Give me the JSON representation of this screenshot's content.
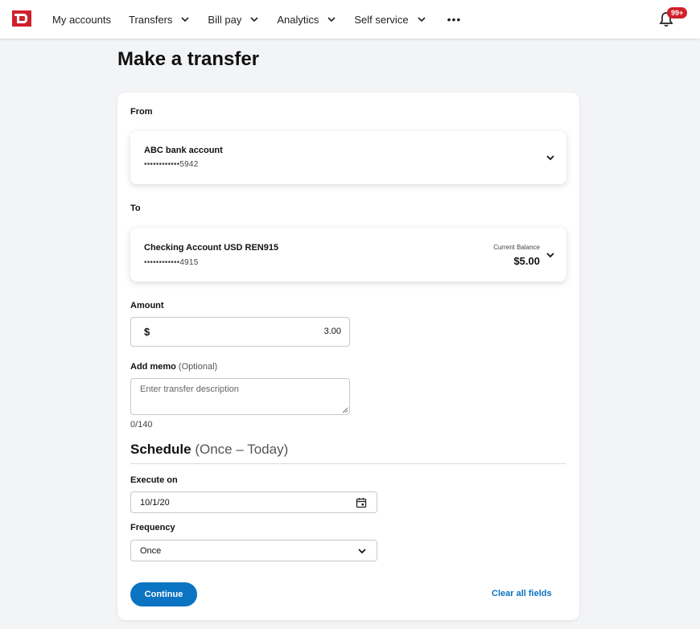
{
  "nav": {
    "items": [
      {
        "label": "My accounts",
        "has_dropdown": false
      },
      {
        "label": "Transfers",
        "has_dropdown": true
      },
      {
        "label": "Bill pay",
        "has_dropdown": true
      },
      {
        "label": "Analytics",
        "has_dropdown": true
      },
      {
        "label": "Self service",
        "has_dropdown": true
      }
    ],
    "more_label": "•••",
    "notification_badge": "99+",
    "brand_color": "#d0202b"
  },
  "page": {
    "title": "Make a transfer"
  },
  "form": {
    "from": {
      "label": "From",
      "account_name": "ABC bank account",
      "account_number": "••••••••••••5942"
    },
    "to": {
      "label": "To",
      "account_name": "Checking Account USD REN915",
      "account_number": "••••••••••••4915",
      "balance_caption": "Current Balance",
      "balance_value": "$5.00"
    },
    "amount": {
      "label": "Amount",
      "currency_symbol": "$",
      "value": "3.00"
    },
    "memo": {
      "label": "Add memo",
      "optional_label": "(Optional)",
      "placeholder": "Enter transfer description",
      "counter": "0/140"
    },
    "schedule": {
      "heading": "Schedule",
      "summary": "(Once – Today)",
      "execute_label": "Execute on",
      "execute_value": "10/1/20",
      "frequency_label": "Frequency",
      "frequency_value": "Once"
    },
    "actions": {
      "continue_label": "Continue",
      "clear_label": "Clear all fields",
      "accent_color": "#0a73c2"
    }
  }
}
